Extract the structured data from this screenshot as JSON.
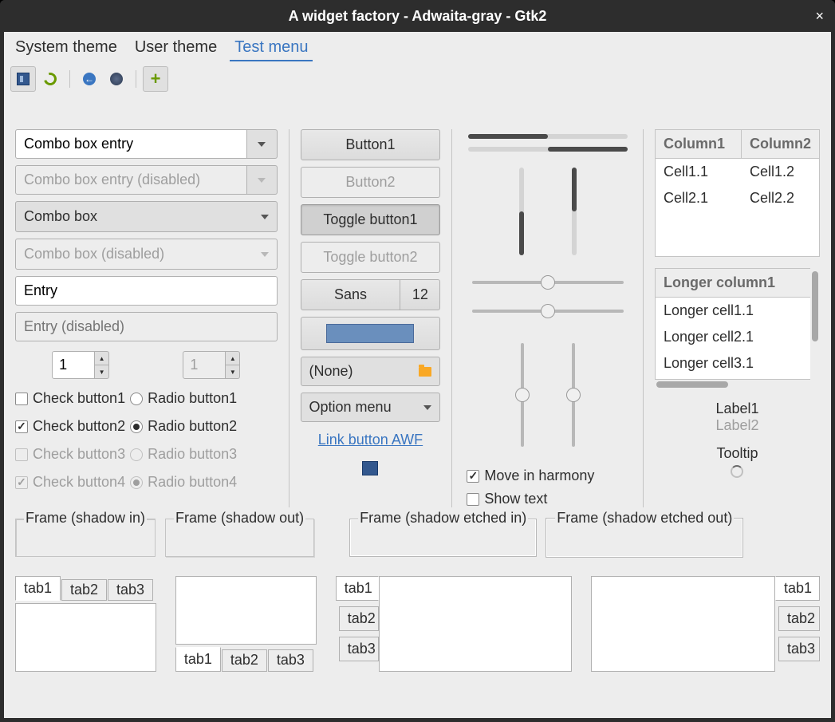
{
  "title": "A widget factory - Adwaita-gray - Gtk2",
  "menubar": [
    "System theme",
    "User theme",
    "Test menu"
  ],
  "menubar_active": 2,
  "col1": {
    "combo_entry": "Combo box entry",
    "combo_entry_disabled": "Combo box entry (disabled)",
    "combo": "Combo box",
    "combo_disabled": "Combo box (disabled)",
    "entry": "Entry",
    "entry_disabled_ph": "Entry (disabled)",
    "spin1": "1",
    "spin2": "1",
    "checks": [
      "Check button1",
      "Check button2",
      "Check button3",
      "Check button4"
    ],
    "radios": [
      "Radio button1",
      "Radio button2",
      "Radio button3",
      "Radio button4"
    ]
  },
  "col2": {
    "button1": "Button1",
    "button2": "Button2",
    "toggle1": "Toggle button1",
    "toggle2": "Toggle button2",
    "font_name": "Sans",
    "font_size": "12",
    "file_none": "(None)",
    "option_menu": "Option menu",
    "link": "Link button AWF"
  },
  "col3": {
    "harmony": "Move in harmony",
    "showtext": "Show text"
  },
  "table1": {
    "headers": [
      "Column1",
      "Column2"
    ],
    "rows": [
      [
        "Cell1.1",
        "Cell1.2"
      ],
      [
        "Cell2.1",
        "Cell2.2"
      ]
    ]
  },
  "table2": {
    "header": "Longer column1",
    "rows": [
      "Longer cell1.1",
      "Longer cell2.1",
      "Longer cell3.1"
    ]
  },
  "labels": {
    "l1": "Label1",
    "l2": "Label2",
    "tt": "Tooltip"
  },
  "frames": [
    "Frame (shadow in)",
    "Frame (shadow out)",
    "Frame (shadow etched in)",
    "Frame (shadow etched out)"
  ],
  "tabs": [
    "tab1",
    "tab2",
    "tab3"
  ]
}
